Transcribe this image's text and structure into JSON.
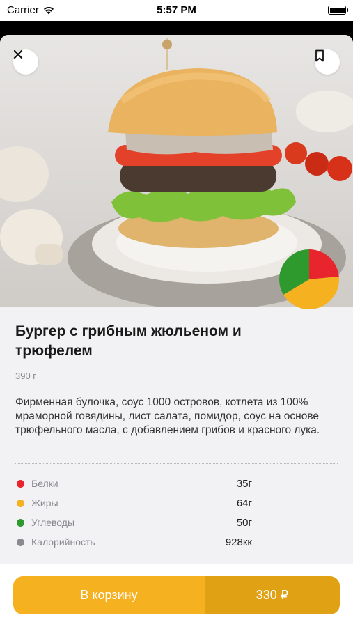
{
  "status_bar": {
    "carrier": "Carrier",
    "time": "5:57 PM",
    "wifi_icon": "wifi-icon",
    "battery_icon": "battery-icon"
  },
  "header": {
    "close_icon": "close-icon",
    "bookmark_icon": "bookmark-icon"
  },
  "product": {
    "image": "burger-photo",
    "title": "Бургер с грибным жюльеном и трюфелем",
    "weight": "390 г",
    "description": "Фирменная булочка, соус 1000 островов, котлета из 100% мраморной говядины, лист салата, помидор, соус на основе трюфельного масла, с добавлением грибов и красного лука."
  },
  "nutrition": [
    {
      "label": "Белки",
      "value": "35г",
      "color": "#e8242c"
    },
    {
      "label": "Жиры",
      "value": "64г",
      "color": "#f5b120"
    },
    {
      "label": "Углеводы",
      "value": "50г",
      "color": "#2e9a2e"
    },
    {
      "label": "Калорийность",
      "value": "928кк",
      "color": "#8a8a8f"
    }
  ],
  "chart_data": {
    "type": "pie",
    "categories": [
      "Белки",
      "Жиры",
      "Углеводы"
    ],
    "values": [
      35,
      64,
      50
    ],
    "colors": [
      "#e8242c",
      "#f5b120",
      "#2e9a2e"
    ]
  },
  "cart": {
    "label": "В корзину",
    "price": "330 ₽",
    "accent": "#f5b120"
  }
}
